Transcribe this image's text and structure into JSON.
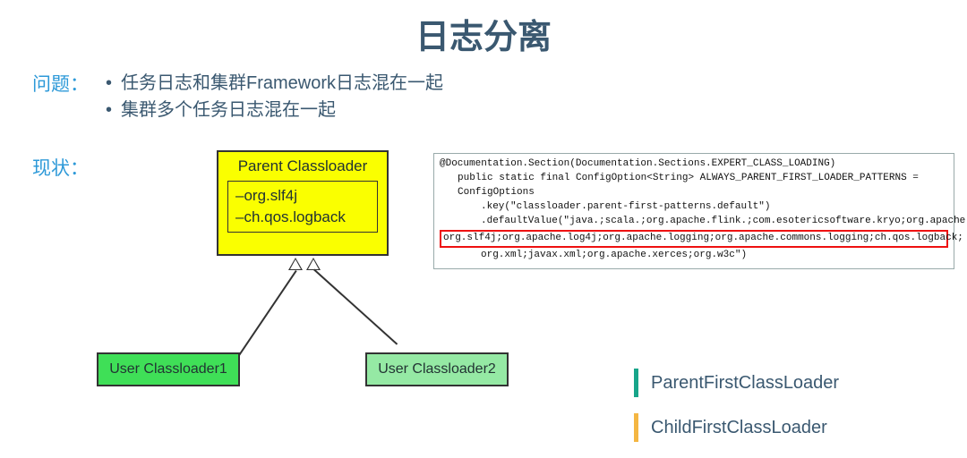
{
  "title": "日志分离",
  "labels": {
    "problem": "问题：",
    "status": "现状："
  },
  "bullets": [
    "任务日志和集群Framework日志混在一起",
    "集群多个任务日志混在一起"
  ],
  "diagram": {
    "parent": {
      "title": "Parent Classloader",
      "lines": [
        "–org.slf4j",
        "–ch.qos.logback"
      ]
    },
    "child1": "User Classloader1",
    "child2": "User Classloader2"
  },
  "code": {
    "l1": "@Documentation.Section(Documentation.Sections.EXPERT_CLASS_LOADING)",
    "l2": "public static final ConfigOption<String> ALWAYS_PARENT_FIRST_LOADER_PATTERNS = ConfigOptions",
    "l3": ".key(\"classloader.parent-first-patterns.default\")",
    "l4": ".defaultValue(\"java.;scala.;org.apache.flink.;com.esotericsoftware.kryo;org.apache.hadoop.;javax.annotation.;",
    "hl": "org.slf4j;org.apache.log4j;org.apache.logging;org.apache.commons.logging;ch.qos.logback;",
    "l5": "org.xml;javax.xml;org.apache.xerces;org.w3c\")"
  },
  "legend": {
    "item1": "ParentFirstClassLoader",
    "item2": "ChildFirstClassLoader"
  }
}
